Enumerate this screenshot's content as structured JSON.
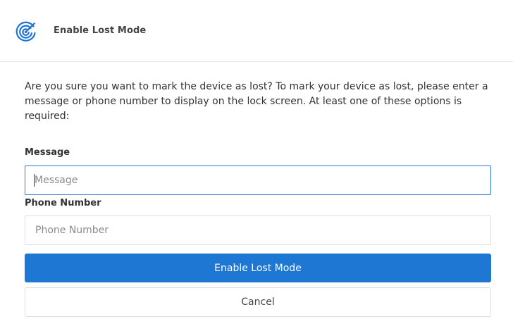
{
  "dialog": {
    "title": "Enable Lost Mode",
    "icon": "radar-icon",
    "accent_color": "#1e77d3",
    "description": "Are you sure you want to mark the device as lost? To mark your device as lost, please enter a message or phone number to display on the lock screen. At least one of these options is required:"
  },
  "fields": {
    "message": {
      "label": "Message",
      "placeholder": "Message",
      "value": ""
    },
    "phone": {
      "label": "Phone Number",
      "placeholder": "Phone Number",
      "value": ""
    }
  },
  "actions": {
    "confirm_label": "Enable Lost Mode",
    "cancel_label": "Cancel"
  }
}
